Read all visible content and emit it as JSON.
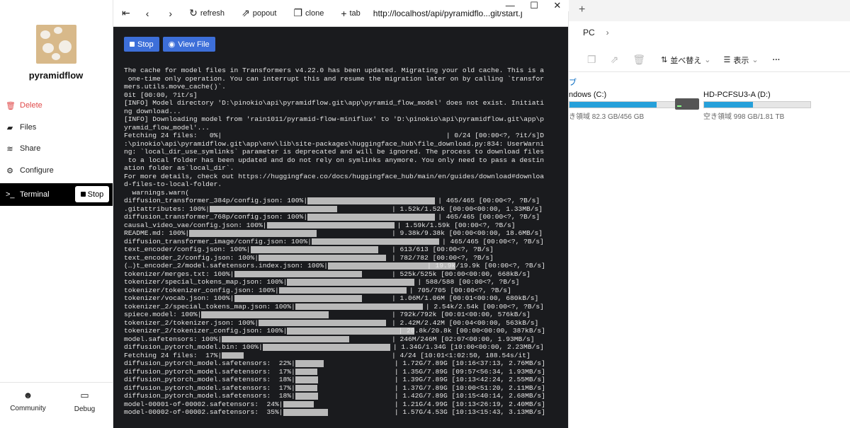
{
  "sidebar": {
    "app_name": "pyramidflow",
    "items": [
      {
        "label": "Delete",
        "icon": "trash-icon"
      },
      {
        "label": "Files",
        "icon": "folder-icon"
      },
      {
        "label": "Share",
        "icon": "wifi-icon"
      },
      {
        "label": "Configure",
        "icon": "gear-icon"
      },
      {
        "label": "Terminal",
        "icon": "terminal-icon"
      }
    ],
    "terminal_stop": "Stop",
    "bottom": {
      "community": "Community",
      "debug": "Debug"
    }
  },
  "browser": {
    "refresh": "refresh",
    "popout": "popout",
    "clone": "clone",
    "tab": "tab",
    "url": "http://localhost/api/pyramidflo...git/start.js"
  },
  "terminal": {
    "stop_label": "Stop",
    "view_file_label": "View File",
    "header_lines": [
      "The cache for model files in Transformers v4.22.0 has been updated. Migrating your old cache. This is a",
      " one-time only operation. You can interrupt this and resume the migration later on by calling `transfor",
      "mers.utils.move_cache()`.",
      "0it [00:00, ?it/s]",
      "[INFO] Model directory 'D:\\pinokio\\api\\pyramidflow.git\\app\\pyramid_flow_model' does not exist. Initiati",
      "ng download...",
      "[INFO] Downloading model from 'rain1011/pyramid-flow-miniflux' to 'D:\\pinokio\\api\\pyramidflow.git\\app\\p",
      "yramid_flow_model'...",
      "Fetching 24 files:   0%|                                                       | 0/24 [00:00<?, ?it/s]D",
      ":\\pinokio\\api\\pyramidflow.git\\app\\env\\lib\\site-packages\\huggingface_hub\\file_download.py:834: UserWarni",
      "ng: `local_dir_use_symlinks` parameter is deprecated and will be ignored. The process to download files",
      " to a local folder has been updated and do not rely on symlinks anymore. You only need to pass a destin",
      "ation folder as`local_dir`.",
      "For more details, check out https://huggingface.co/docs/huggingface_hub/main/en/guides/download#downloa",
      "d-files-to-local-folder.",
      "  warnings.warn("
    ],
    "progress_lines": [
      {
        "label": "diffusion_transformer_384p/config.json: 100%|",
        "stats": "| 465/465 [00:00<?, ?B/s]",
        "progress": 1.0
      },
      {
        "label": ".gitattributes: 100%|",
        "stats": "| 1.52k/1.52k [00:00<00:00, 1.33MB/s]",
        "progress": 1.0
      },
      {
        "label": "diffusion_transformer_768p/config.json: 100%|",
        "stats": "| 465/465 [00:00<?, ?B/s]",
        "progress": 1.0
      },
      {
        "label": "causal_video_vae/config.json: 100%|",
        "stats": "| 1.59k/1.59k [00:00<?, ?B/s]",
        "progress": 1.0
      },
      {
        "label": "README.md: 100%|",
        "stats": "| 9.38k/9.38k [00:00<00:00, 18.6MB/s]",
        "progress": 1.0
      },
      {
        "label": "diffusion_transformer_image/config.json: 100%|",
        "stats": "| 465/465 [00:00<?, ?B/s]",
        "progress": 1.0
      },
      {
        "label": "text_encoder/config.json: 100%|",
        "stats": "| 613/613 [00:00<?, ?B/s]",
        "progress": 1.0
      },
      {
        "label": "text_encoder_2/config.json: 100%|",
        "stats": "| 782/782 [00:00<?, ?B/s]",
        "progress": 1.0
      },
      {
        "label": "(…)t_encoder_2/model.safetensors.index.json: 100%|",
        "stats": "| 19.9k/19.9k [00:00<?, ?B/s]",
        "progress": 1.0
      },
      {
        "label": "tokenizer/merges.txt: 100%|",
        "stats": "| 525k/525k [00:00<00:00, 668kB/s]",
        "progress": 1.0
      },
      {
        "label": "tokenizer/special_tokens_map.json: 100%|",
        "stats": "| 588/588 [00:00<?, ?B/s]",
        "progress": 1.0
      },
      {
        "label": "tokenizer/tokenizer_config.json: 100%|",
        "stats": "| 705/705 [00:00<?, ?B/s]",
        "progress": 1.0
      },
      {
        "label": "tokenizer/vocab.json: 100%|",
        "stats": "| 1.06M/1.06M [00:01<00:00, 680kB/s]",
        "progress": 1.0
      },
      {
        "label": "tokenizer_2/special_tokens_map.json: 100%|",
        "stats": "| 2.54k/2.54k [00:00<?, ?B/s]",
        "progress": 1.0
      },
      {
        "label": "spiece.model: 100%|",
        "stats": "| 792k/792k [00:01<00:00, 576kB/s]",
        "progress": 1.0
      },
      {
        "label": "tokenizer_2/tokenizer.json: 100%|",
        "stats": "| 2.42M/2.42M [00:04<00:00, 563kB/s]",
        "progress": 1.0
      },
      {
        "label": "tokenizer_2/tokenizer_config.json: 100%|",
        "stats": "| 20.8k/20.8k [00:00<00:00, 387kB/s]",
        "progress": 1.0
      },
      {
        "label": "model.safetensors: 100%|",
        "stats": "| 246M/246M [02:07<00:00, 1.93MB/s]",
        "progress": 1.0
      },
      {
        "label": "diffusion_pytorch_model.bin: 100%|",
        "stats": "| 1.34G/1.34G [10:00<00:00, 2.23MB/s]",
        "progress": 1.0
      },
      {
        "label": "Fetching 24 files:  17%|",
        "stats": "| 4/24 [10:01<1:02:50, 188.54s/it]",
        "progress": 0.17
      },
      {
        "label": "diffusion_pytorch_model.safetensors:  22%|",
        "stats": "| 1.72G/7.89G [10:16<37:13, 2.76MB/s]",
        "progress": 0.22
      },
      {
        "label": "diffusion_pytorch_model.safetensors:  17%|",
        "stats": "| 1.35G/7.89G [09:57<56:34, 1.93MB/s]",
        "progress": 0.17
      },
      {
        "label": "diffusion_pytorch_model.safetensors:  18%|",
        "stats": "| 1.39G/7.89G [10:13<42:24, 2.55MB/s]",
        "progress": 0.18
      },
      {
        "label": "diffusion_pytorch_model.safetensors:  17%|",
        "stats": "| 1.37G/7.89G [10:00<51:20, 2.11MB/s]",
        "progress": 0.17
      },
      {
        "label": "diffusion_pytorch_model.safetensors:  18%|",
        "stats": "| 1.42G/7.89G [10:15<40:14, 2.68MB/s]",
        "progress": 0.18
      },
      {
        "label": "model-00001-of-00002.safetensors:  24%|",
        "stats": "| 1.21G/4.99G [10:13<26:19, 2.40MB/s]",
        "progress": 0.24
      },
      {
        "label": "model-00002-of-00002.safetensors:  35%|",
        "stats": "| 1.57G/4.53G [10:13<15:43, 3.13MB/s]",
        "progress": 0.35
      }
    ]
  },
  "explorer": {
    "breadcrumb": "PC",
    "sort_label": "並べ替え",
    "view_label": "表示",
    "section_label": "ブ",
    "drives": [
      {
        "name": "ndows (C:)",
        "info": "き領域 82.3 GB/456 GB",
        "usage": 0.82
      },
      {
        "name": "HD-PCFSU3-A (D:)",
        "info": "空き領域 998 GB/1.81 TB",
        "usage": 0.46
      }
    ]
  },
  "colors": {
    "terminal_bg": "#1a1b1e",
    "accent_blue": "#3d6fd9",
    "drive_fill": "#26a0da",
    "delete_red": "#e04a4a"
  }
}
